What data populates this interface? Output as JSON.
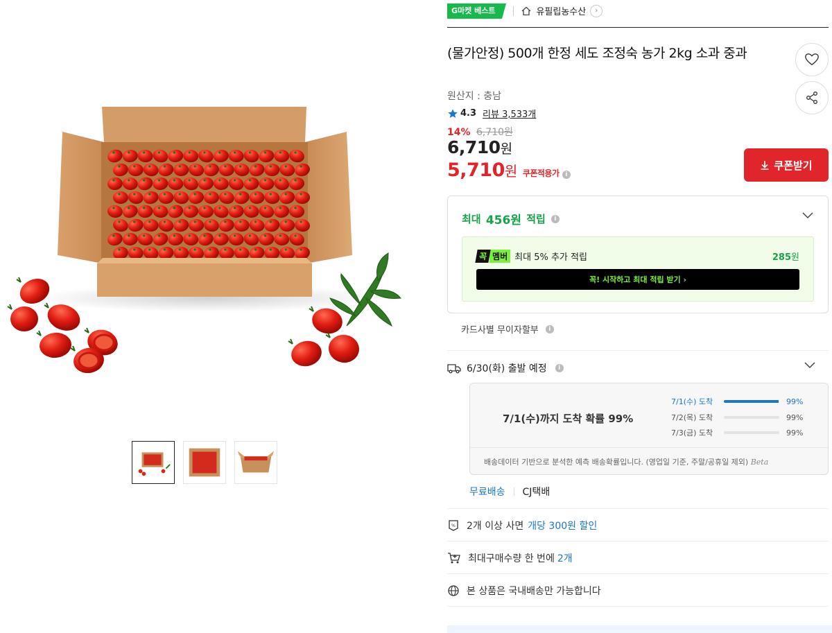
{
  "gallery": {
    "thumbnail_count": 3,
    "active_thumbnail": 0
  },
  "header": {
    "badge": "G마켓 베스트",
    "shop_name": "유필립농수산"
  },
  "product": {
    "title": "(물가안정) 500개 한정 세도 조정숙 농가 2kg 소과 중과",
    "origin": "원산지 : 충남",
    "rating": "4.3",
    "review_label": "리뷰 3,533개",
    "discount_pct": "14%",
    "original_price": "6,710원",
    "price": "6,710",
    "price_unit": "원",
    "coupon_price": "5,710",
    "coupon_price_unit": "원",
    "coupon_tag": "쿠폰적용가"
  },
  "coupon_button": {
    "label": "쿠폰받기"
  },
  "reward": {
    "prefix": "최대",
    "amount": "456원",
    "suffix": "적립",
    "member_badge_1": "꼭",
    "member_badge_2": "멤버",
    "member_text": "최대 5% 추가 적립",
    "member_points": "285",
    "member_points_unit": "원",
    "member_button": "꼭! 시작하고 최대 적립 받기  ›"
  },
  "card_installment": "카드사별 무이자할부",
  "shipping": {
    "depart": "6/30(화) 출발 예정",
    "prob_title": "7/1(수)까지 도착 확률 99%",
    "lines": [
      {
        "label": "7/1(수) 도착",
        "pct": "99%",
        "fill": 0.99,
        "active": true
      },
      {
        "label": "7/2(목) 도착",
        "pct": "99%",
        "fill": 0.0,
        "active": false
      },
      {
        "label": "7/3(금) 도착",
        "pct": "99%",
        "fill": 0.0,
        "active": false
      }
    ],
    "note": "배송데이터 기반으로 분석한 예측 배송확률입니다. (영업일 기준, 주말/공휴일 제외)",
    "beta": "Beta",
    "free_shipping": "무료배송",
    "carrier": "CJ택배"
  },
  "features": {
    "bulk_prefix": "2개 이상 사면",
    "bulk_highlight": "개당 300원 할인",
    "max_prefix": "최대구매수량 한 번에",
    "max_highlight": "2개",
    "domestic": "본 상품은 국내배송만 가능합니다"
  },
  "colors": {
    "accent_red": "#e1262b",
    "accent_green": "#16a34a",
    "link_blue": "#1976d2",
    "best_green": "#16b94c"
  }
}
